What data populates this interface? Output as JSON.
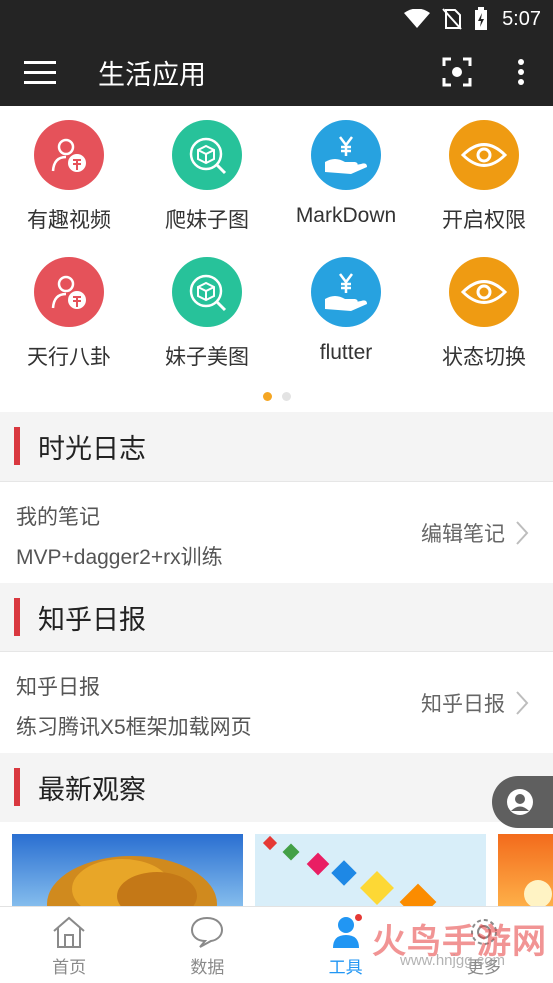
{
  "status_bar": {
    "time": "5:07"
  },
  "toolbar": {
    "title": "生活应用"
  },
  "grid": {
    "items": [
      {
        "label": "有趣视频",
        "icon": "user-coin-icon",
        "color": "#e5525a"
      },
      {
        "label": "爬妹子图",
        "icon": "box-search-icon",
        "color": "#27c29a"
      },
      {
        "label": "MarkDown",
        "icon": "yen-hand-icon",
        "color": "#27a2e0"
      },
      {
        "label": "开启权限",
        "icon": "eye-icon",
        "color": "#ef9b12"
      },
      {
        "label": "天行八卦",
        "icon": "user-coin-icon",
        "color": "#e5525a"
      },
      {
        "label": "妹子美图",
        "icon": "box-search-icon",
        "color": "#27c29a"
      },
      {
        "label": "flutter",
        "icon": "yen-hand-icon",
        "color": "#27a2e0"
      },
      {
        "label": "状态切换",
        "icon": "eye-icon",
        "color": "#ef9b12"
      }
    ],
    "page_indicator": {
      "pages": 2,
      "current": 1
    }
  },
  "sections": [
    {
      "title": "时光日志",
      "line1": "我的笔记",
      "line2": "MVP+dagger2+rx训练",
      "action": "编辑笔记"
    },
    {
      "title": "知乎日报",
      "line1": "知乎日报",
      "line2": "练习腾讯X5框架加载网页",
      "action": "知乎日报"
    },
    {
      "title": "最新观察"
    }
  ],
  "bottom_nav": [
    {
      "label": "首页",
      "icon": "home-icon"
    },
    {
      "label": "数据",
      "icon": "chat-bubble-icon"
    },
    {
      "label": "工具",
      "icon": "person-icon",
      "active": true
    },
    {
      "label": "更多",
      "icon": "gear-icon"
    }
  ],
  "watermark": {
    "text": "火鸟手游网",
    "url": "www.hnjgg.com"
  },
  "colors": {
    "accent": "#2196f3",
    "section_bar": "#d9383f",
    "toolbar": "#242424"
  }
}
